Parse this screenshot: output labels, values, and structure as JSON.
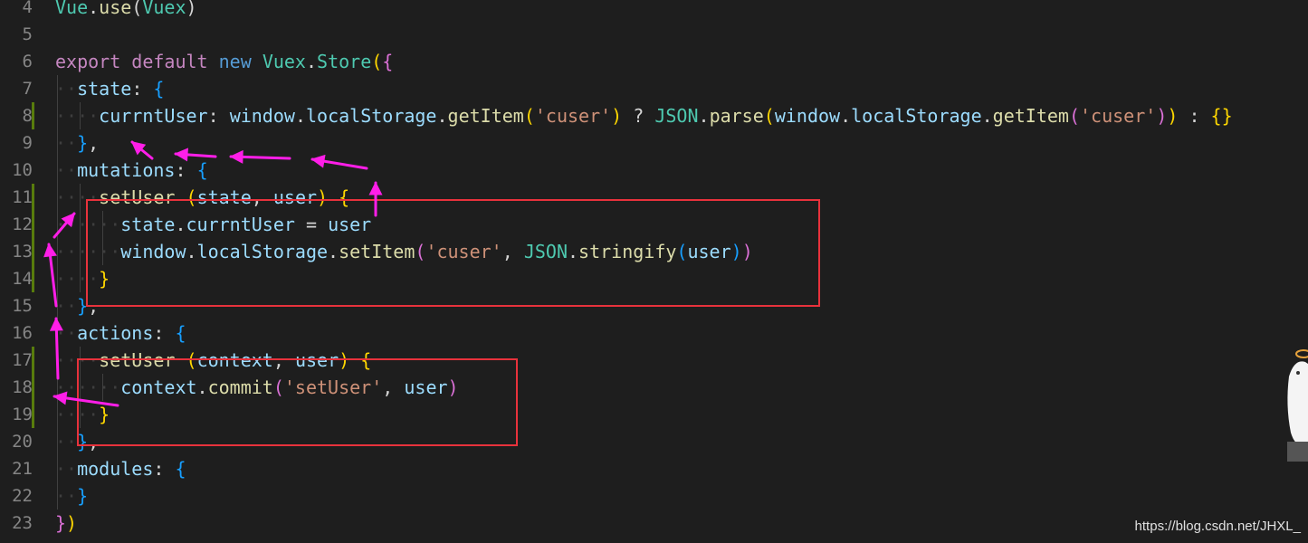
{
  "editor": {
    "lines": [
      {
        "n": "4",
        "tokens": [
          [
            "cls",
            "Vue"
          ],
          [
            "pun",
            "."
          ],
          [
            "fn",
            "use"
          ],
          [
            "pun",
            "("
          ],
          [
            "cls",
            "Vuex"
          ],
          [
            "pun",
            ")"
          ]
        ]
      },
      {
        "n": "5",
        "tokens": []
      },
      {
        "n": "6",
        "tokens": [
          [
            "kw",
            "export"
          ],
          [
            "pun",
            " "
          ],
          [
            "kw",
            "default"
          ],
          [
            "pun",
            " "
          ],
          [
            "kw2",
            "new"
          ],
          [
            "pun",
            " "
          ],
          [
            "cls",
            "Vuex"
          ],
          [
            "pun",
            "."
          ],
          [
            "cls",
            "Store"
          ],
          [
            "br1",
            "("
          ],
          [
            "br2",
            "{"
          ]
        ]
      },
      {
        "n": "7",
        "mark": false,
        "tokens": [
          [
            "ws",
            "··"
          ],
          [
            "var",
            "state"
          ],
          [
            "pun",
            ": "
          ],
          [
            "br3",
            "{"
          ]
        ]
      },
      {
        "n": "8",
        "mark": true,
        "tokens": [
          [
            "ws",
            "····"
          ],
          [
            "var",
            "currntUser"
          ],
          [
            "pun",
            ": "
          ],
          [
            "var",
            "window"
          ],
          [
            "pun",
            "."
          ],
          [
            "var",
            "localStorage"
          ],
          [
            "pun",
            "."
          ],
          [
            "fn",
            "getItem"
          ],
          [
            "br1",
            "("
          ],
          [
            "str",
            "'cuser'"
          ],
          [
            "br1",
            ")"
          ],
          [
            "pun",
            " ? "
          ],
          [
            "cls",
            "JSON"
          ],
          [
            "pun",
            "."
          ],
          [
            "fn",
            "parse"
          ],
          [
            "br1",
            "("
          ],
          [
            "var",
            "window"
          ],
          [
            "pun",
            "."
          ],
          [
            "var",
            "localStorage"
          ],
          [
            "pun",
            "."
          ],
          [
            "fn",
            "getItem"
          ],
          [
            "br2",
            "("
          ],
          [
            "str",
            "'cuser'"
          ],
          [
            "br2",
            ")"
          ],
          [
            "br1",
            ")"
          ],
          [
            "pun",
            " : "
          ],
          [
            "br1",
            "{}"
          ]
        ]
      },
      {
        "n": "9",
        "tokens": [
          [
            "ws",
            "··"
          ],
          [
            "br3",
            "}"
          ],
          [
            "pun",
            ","
          ]
        ]
      },
      {
        "n": "10",
        "tokens": [
          [
            "ws",
            "··"
          ],
          [
            "var",
            "mutations"
          ],
          [
            "pun",
            ": "
          ],
          [
            "br3",
            "{"
          ]
        ]
      },
      {
        "n": "11",
        "mark": true,
        "tokens": [
          [
            "ws",
            "····"
          ],
          [
            "fn",
            "setUser"
          ],
          [
            "pun",
            " "
          ],
          [
            "br1",
            "("
          ],
          [
            "var",
            "state"
          ],
          [
            "pun",
            ", "
          ],
          [
            "var",
            "user"
          ],
          [
            "br1",
            ")"
          ],
          [
            "pun",
            " "
          ],
          [
            "br1",
            "{"
          ]
        ]
      },
      {
        "n": "12",
        "mark": true,
        "tokens": [
          [
            "ws",
            "······"
          ],
          [
            "var",
            "state"
          ],
          [
            "pun",
            "."
          ],
          [
            "var",
            "currntUser"
          ],
          [
            "pun",
            " = "
          ],
          [
            "var",
            "user"
          ]
        ]
      },
      {
        "n": "13",
        "mark": true,
        "tokens": [
          [
            "ws",
            "······"
          ],
          [
            "var",
            "window"
          ],
          [
            "pun",
            "."
          ],
          [
            "var",
            "localStorage"
          ],
          [
            "pun",
            "."
          ],
          [
            "fn",
            "setItem"
          ],
          [
            "br2",
            "("
          ],
          [
            "str",
            "'cuser'"
          ],
          [
            "pun",
            ", "
          ],
          [
            "cls",
            "JSON"
          ],
          [
            "pun",
            "."
          ],
          [
            "fn",
            "stringify"
          ],
          [
            "br3",
            "("
          ],
          [
            "var",
            "user"
          ],
          [
            "br3",
            ")"
          ],
          [
            "br2",
            ")"
          ]
        ]
      },
      {
        "n": "14",
        "mark": true,
        "tokens": [
          [
            "ws",
            "····"
          ],
          [
            "br1",
            "}"
          ]
        ]
      },
      {
        "n": "15",
        "tokens": [
          [
            "ws",
            "··"
          ],
          [
            "br3",
            "}"
          ],
          [
            "pun",
            ","
          ]
        ]
      },
      {
        "n": "16",
        "tokens": [
          [
            "ws",
            "··"
          ],
          [
            "var",
            "actions"
          ],
          [
            "pun",
            ": "
          ],
          [
            "br3",
            "{"
          ]
        ]
      },
      {
        "n": "17",
        "mark": true,
        "tokens": [
          [
            "ws",
            "····"
          ],
          [
            "fn",
            "setUser"
          ],
          [
            "pun",
            " "
          ],
          [
            "br1",
            "("
          ],
          [
            "var",
            "context"
          ],
          [
            "pun",
            ", "
          ],
          [
            "var",
            "user"
          ],
          [
            "br1",
            ")"
          ],
          [
            "pun",
            " "
          ],
          [
            "br1",
            "{"
          ]
        ]
      },
      {
        "n": "18",
        "mark": true,
        "tokens": [
          [
            "ws",
            "······"
          ],
          [
            "var",
            "context"
          ],
          [
            "pun",
            "."
          ],
          [
            "fn",
            "commit"
          ],
          [
            "br2",
            "("
          ],
          [
            "str",
            "'setUser'"
          ],
          [
            "pun",
            ", "
          ],
          [
            "var",
            "user"
          ],
          [
            "br2",
            ")"
          ]
        ]
      },
      {
        "n": "19",
        "mark": true,
        "tokens": [
          [
            "ws",
            "····"
          ],
          [
            "br1",
            "}"
          ]
        ]
      },
      {
        "n": "20",
        "tokens": [
          [
            "ws",
            "··"
          ],
          [
            "br3",
            "}"
          ],
          [
            "pun",
            ","
          ]
        ]
      },
      {
        "n": "21",
        "tokens": [
          [
            "ws",
            "··"
          ],
          [
            "var",
            "modules"
          ],
          [
            "pun",
            ": "
          ],
          [
            "br3",
            "{"
          ]
        ]
      },
      {
        "n": "22",
        "tokens": [
          [
            "ws",
            "··"
          ],
          [
            "br3",
            "}"
          ]
        ]
      },
      {
        "n": "23",
        "tokens": [
          [
            "br2",
            "}"
          ],
          [
            "br1",
            ")"
          ]
        ]
      }
    ]
  },
  "annotations": {
    "highlight_color": "#e8323c",
    "arrow_color": "#ff1ee8"
  },
  "watermark": {
    "text": "https://blog.csdn.net/JHXL_"
  }
}
